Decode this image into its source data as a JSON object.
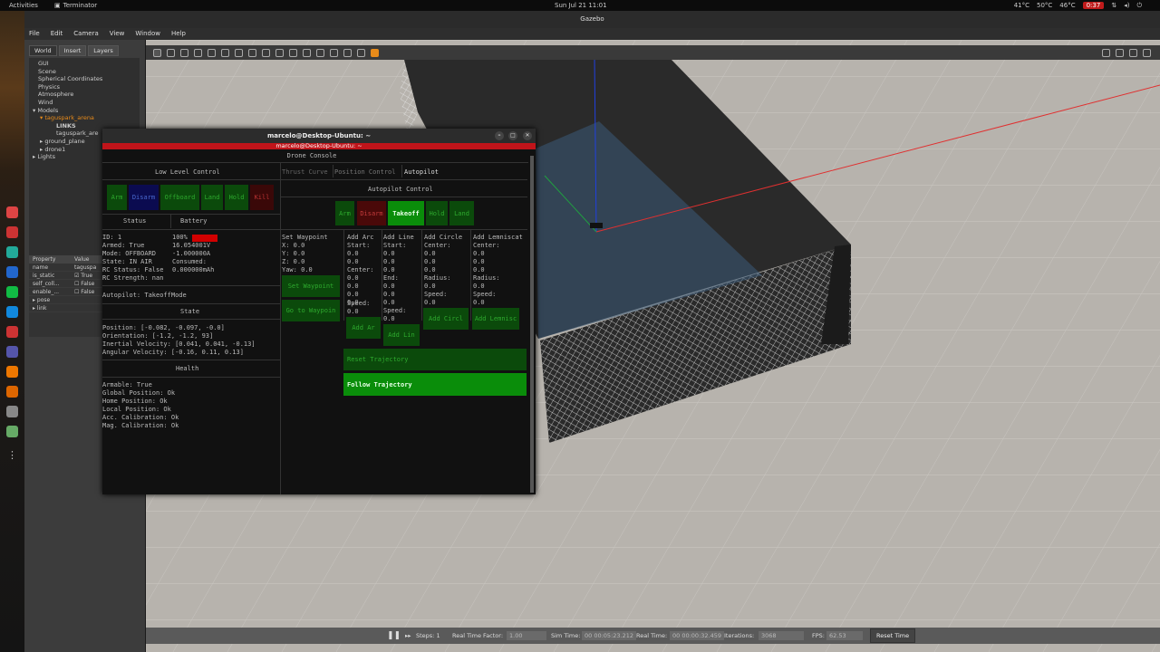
{
  "topbar": {
    "activities": "Activities",
    "app": "Terminator",
    "clock": "Sun Jul 21  11:01",
    "temp1": "41°C",
    "temp2": "50°C",
    "temp3": "46°C",
    "rec": "0:37"
  },
  "gazebo": {
    "title": "Gazebo",
    "menu": [
      "File",
      "Edit",
      "Camera",
      "View",
      "Window",
      "Help"
    ],
    "tabs": [
      "World",
      "Insert",
      "Layers"
    ],
    "tree": [
      "GUI",
      "Scene",
      "Spherical Coordinates",
      "Physics",
      "Atmosphere",
      "Wind",
      "Models",
      "taguspark_arena",
      "LINKS",
      "taguspark_are",
      "ground_plane",
      "drone1",
      "Lights"
    ],
    "props": {
      "header": [
        "Property",
        "Value"
      ],
      "rows": [
        [
          "name",
          "taguspa"
        ],
        [
          "is_static",
          "True"
        ],
        [
          "self_coll...",
          "False"
        ],
        [
          "enable_...",
          "False"
        ],
        [
          "pose",
          ""
        ],
        [
          "link",
          ""
        ]
      ]
    },
    "status": {
      "steps_label": "Steps: 1",
      "rtf_label": "Real Time Factor:",
      "rtf": "1.00",
      "sim_label": "Sim Time:",
      "sim": "00 00:05:23.212",
      "real_label": "Real Time:",
      "real": "00 00:00:32.459",
      "iter_label": "Iterations:",
      "iter": "3068",
      "fps_label": "FPS:",
      "fps": "62.53",
      "reset": "Reset Time"
    }
  },
  "terminal": {
    "title": "marcelo@Desktop-Ubuntu: ~",
    "subtitle": "marcelo@Desktop-Ubuntu: ~",
    "console_title": "Drone Console",
    "low_level": {
      "title": "Low Level Control",
      "buttons": [
        "Arm",
        "Disarm",
        "Offboard",
        "Land",
        "Hold",
        "Kill"
      ]
    },
    "status_title": "Status",
    "battery_title": "Battery",
    "status_lines": [
      "ID: 1",
      "Armed: True",
      "Mode: OFFBOARD",
      "State: IN AIR",
      "RC Status: False",
      "RC Strength: nan"
    ],
    "battery_lines": [
      "100%",
      "16.054001V",
      "-1.000000A",
      "Consumed:",
      "0.000000mAh"
    ],
    "battery_level": 1.0,
    "autopilot_mode": "Autopilot: TakeoffMode",
    "state_title": "State",
    "state_lines": [
      "Position: [-0.082, -0.097, -0.0]",
      "Orientation: [-1.2, -1.2, 93]",
      "Inertial Velocity: [0.041, 0.041, -0.13]",
      "Angular Velocity: [-0.16, 0.11, 0.13]"
    ],
    "health_title": "Health",
    "health_lines": [
      "Armable: True",
      "Global Position: Ok",
      "Home Position: Ok",
      "Local Position: Ok",
      "Acc. Calibration: Ok",
      "Mag. Calibration: Ok"
    ],
    "tabs": [
      "Thrust Curve",
      "Position Control",
      "Autopilot"
    ],
    "autopilot": {
      "title": "Autopilot Control",
      "buttons": [
        "Arm",
        "Disarm",
        "Takeoff",
        "Hold",
        "Land"
      ]
    },
    "waypoint": {
      "title": "Set Waypoint",
      "lines": [
        "X: 0.0",
        "Y: 0.0",
        "Z: 0.0",
        "Yaw: 0.0"
      ],
      "set": "Set Waypoint",
      "go": "Go to Waypoin"
    },
    "arc": {
      "title": "Add Arc",
      "lines": [
        "Start:",
        "0.0",
        "0.0",
        "Center:",
        "0.0",
        "0.0",
        "0.0",
        "0.0",
        "Speed:",
        "0.0"
      ],
      "btn": "Add Ar"
    },
    "line": {
      "title": "Add Line",
      "lines": [
        "Start:",
        "0.0",
        "0.0",
        "0.0",
        "End:",
        "0.0",
        "0.0",
        "0.0",
        "Speed:",
        "0.0"
      ],
      "btn": "Add Lin"
    },
    "circle": {
      "title": "Add Circle",
      "lines": [
        "Center:",
        "0.0",
        "0.0",
        "0.0",
        "",
        "Radius:",
        "0.0",
        "Speed:",
        "0.0"
      ],
      "btn": "Add Circl"
    },
    "lemn": {
      "title": "Add Lemniscat",
      "lines": [
        "Center:",
        "0.0",
        "0.0",
        "0.0",
        "",
        "Radius:",
        "0.0",
        "Speed:",
        "0.0"
      ],
      "btn": "Add Lemnisc"
    },
    "reset": "Reset Trajectory",
    "follow": "Follow Trajectory"
  },
  "colors": {
    "green_btn": "#0b4a0b",
    "green_active": "#0a8d0a",
    "red_title": "#c0141a",
    "battery": "#d10000"
  }
}
